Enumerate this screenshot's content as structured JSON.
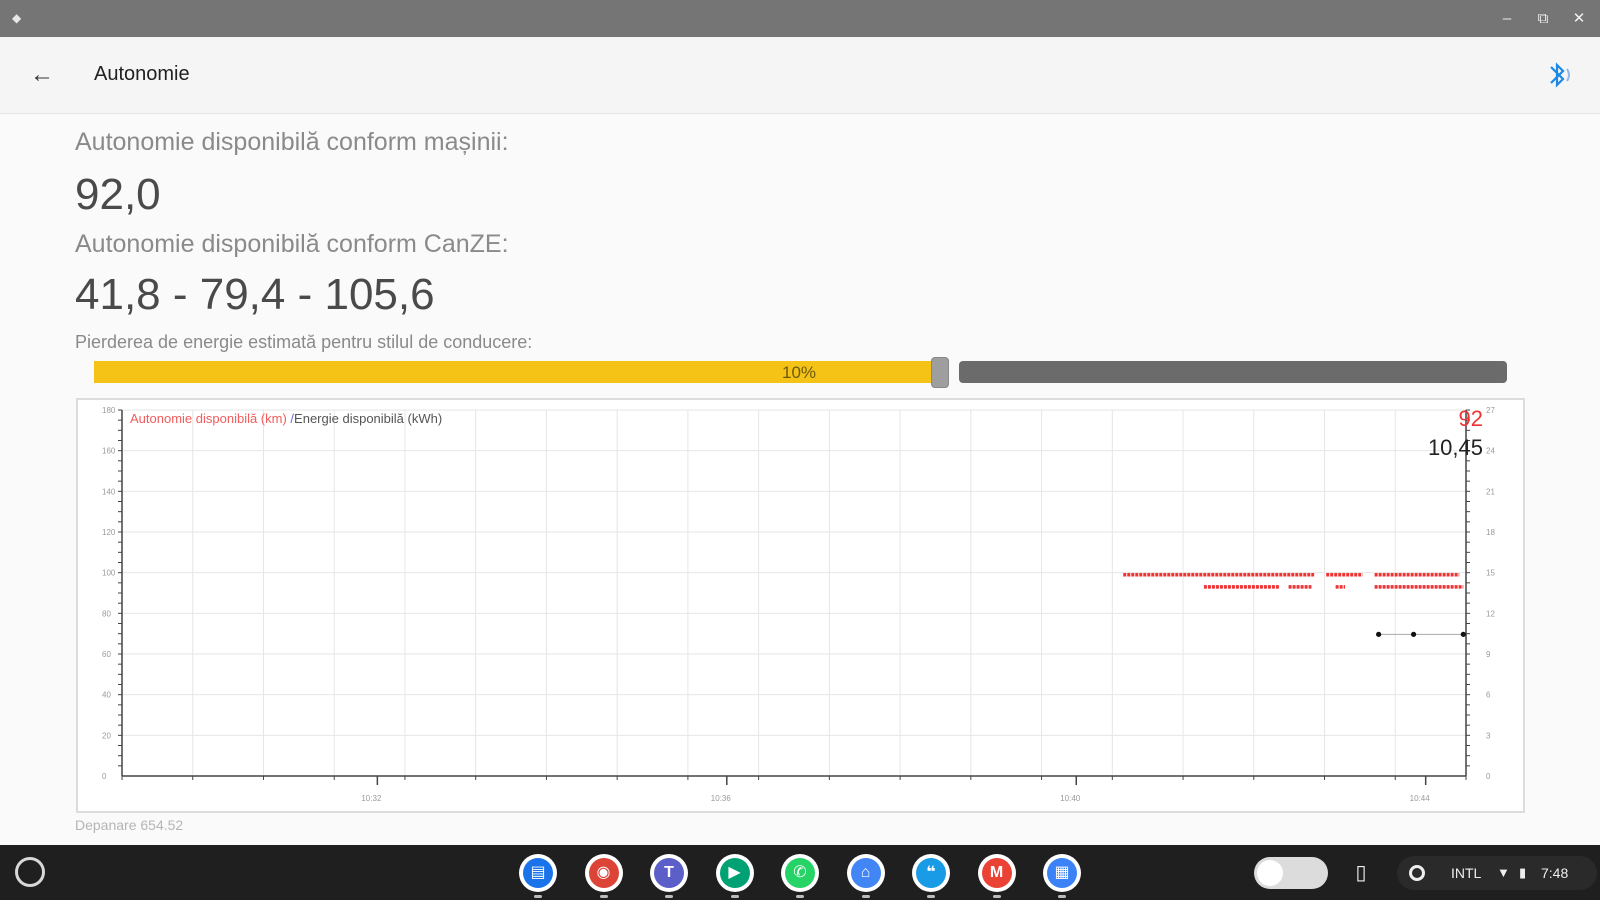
{
  "window": {
    "minimize": "–",
    "maximize": "⧉",
    "close": "✕"
  },
  "appbar": {
    "title": "Autonomie",
    "back_icon": "arrow-left-icon",
    "bluetooth_icon": "bluetooth-icon"
  },
  "main": {
    "car_range_label": "Autonomie disponibilă conform mașinii:",
    "car_range_value": "92,0",
    "canze_range_label": "Autonomie disponibilă conform CanZE:",
    "canze_range_value": "41,8 - 79,4 - 105,6",
    "energy_loss_label": "Pierderea de energie estimată pentru stilul de conducere:",
    "energy_loss_slider": {
      "percent_label": "10%",
      "fraction": 0.6,
      "fill_color": "#f5c216"
    },
    "footer": "Depanare 654.52"
  },
  "chart_data": {
    "type": "scatter",
    "legend": [
      "Autonomie disponibilă (km)",
      "/",
      "Energie disponibilă (kWh)"
    ],
    "current_values": {
      "range_km": "92",
      "energy_kwh": "10,45"
    },
    "left_axis": {
      "ticks": [
        "180",
        "160",
        "140",
        "120",
        "100",
        "80",
        "60",
        "40",
        "20",
        "0"
      ]
    },
    "right_axis": {
      "ticks": [
        "27",
        "24",
        "21",
        "18",
        "15",
        "12",
        "9",
        "6",
        "3",
        "0"
      ]
    },
    "x_ticks": [
      "10:32",
      "10:36",
      "10:40",
      "10:44"
    ],
    "grid": true,
    "series": [
      {
        "name": "Autonomie disponibilă (km)",
        "color": "#ee3333",
        "segments": [
          {
            "y": 99,
            "x_from": 0.745,
            "x_to": 0.887
          },
          {
            "y": 99,
            "x_from": 0.896,
            "x_to": 0.923
          },
          {
            "y": 99,
            "x_from": 0.932,
            "x_to": 0.995
          },
          {
            "y": 93,
            "x_from": 0.805,
            "x_to": 0.861
          },
          {
            "y": 93,
            "x_from": 0.868,
            "x_to": 0.885
          },
          {
            "y": 93,
            "x_from": 0.903,
            "x_to": 0.91
          },
          {
            "y": 93,
            "x_from": 0.932,
            "x_to": 0.998
          }
        ]
      },
      {
        "name": "Energie disponibilă (kWh)",
        "color": "#111111",
        "points": [
          {
            "x": 0.935,
            "y": 10.45
          },
          {
            "x": 0.961,
            "y": 10.45
          },
          {
            "x": 0.998,
            "y": 10.45
          }
        ]
      }
    ]
  },
  "shelf": {
    "apps": [
      {
        "name": "app-files-icon",
        "color": "#1a73e8",
        "glyph": "▤"
      },
      {
        "name": "chrome-icon",
        "color": "#db4437",
        "glyph": "◉"
      },
      {
        "name": "teams-icon",
        "color": "#5b5fc7",
        "glyph": "T"
      },
      {
        "name": "play-store-icon",
        "color": "#00a173",
        "glyph": "▶"
      },
      {
        "name": "whatsapp-icon",
        "color": "#25d366",
        "glyph": "✆"
      },
      {
        "name": "home-icon",
        "color": "#4285f4",
        "glyph": "⌂"
      },
      {
        "name": "chat-icon",
        "color": "#1a9be6",
        "glyph": "❝"
      },
      {
        "name": "gmail-icon",
        "color": "#ea4335",
        "glyph": "M"
      },
      {
        "name": "calendar-icon",
        "color": "#3b82f6",
        "glyph": "▦"
      }
    ],
    "keyboard": "INTL",
    "time": "7:48"
  }
}
